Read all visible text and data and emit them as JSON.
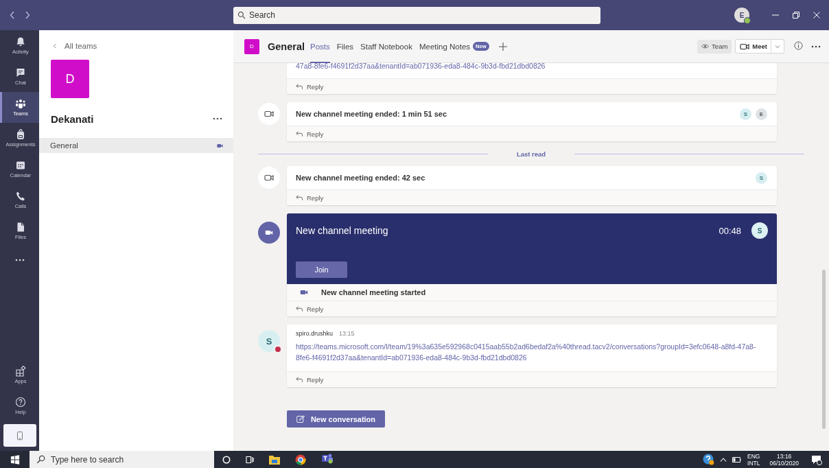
{
  "title_bar": {
    "search": {
      "placeholder": "Search"
    },
    "user": {
      "initial": "E",
      "color": "#92c353"
    }
  },
  "app_bar": {
    "items": [
      {
        "label": "Activity",
        "selected": false
      },
      {
        "label": "Chat",
        "selected": false
      },
      {
        "label": "Teams",
        "selected": true
      },
      {
        "label": "Assignments",
        "selected": false
      },
      {
        "label": "Calendar",
        "selected": false
      },
      {
        "label": "Calls",
        "selected": false
      },
      {
        "label": "Files",
        "selected": false
      }
    ],
    "bottom_items": [
      {
        "label": "Apps"
      },
      {
        "label": "Help"
      }
    ]
  },
  "team_panel": {
    "back_link": "All teams",
    "team_initial": "D",
    "team_name": "Dekanati",
    "channels": [
      {
        "name": "General",
        "selected": true,
        "meeting_active": true
      }
    ]
  },
  "channel_header": {
    "team_initial": "D",
    "channel_name": "General",
    "tabs": [
      {
        "label": "Posts",
        "selected": true
      },
      {
        "label": "Files",
        "selected": false
      },
      {
        "label": "Staff Notebook",
        "selected": false
      },
      {
        "label": "Meeting Notes",
        "selected": false,
        "badge": "New"
      }
    ],
    "team_button": "Team",
    "meet_button": "Meet"
  },
  "posts": [
    {
      "kind": "link_tail",
      "link": "47a8-8fe6-f4691f2d37aa&tenantId=ab071936-eda8-484c-9b3d-fbd21dbd0826",
      "reply": "Reply"
    },
    {
      "kind": "event",
      "text": "New channel meeting ended: 1 min 51 sec",
      "participants": [
        "S",
        "E"
      ],
      "reply": "Reply"
    },
    {
      "kind": "divider",
      "label": "Last read"
    },
    {
      "kind": "event",
      "text": "New channel meeting ended: 42 sec",
      "participants": [
        "S"
      ],
      "reply": "Reply"
    },
    {
      "kind": "meeting",
      "title": "New channel meeting",
      "duration": "00:48",
      "participants": [
        "S"
      ],
      "join": "Join",
      "status": "New channel meeting started",
      "reply": "Reply"
    },
    {
      "kind": "message",
      "initial": "S",
      "color": "#c4314b",
      "author": "spiro.drushku",
      "time": "13:15",
      "link": "https://teams.microsoft.com/l/team/19%3a635e592968c0415aab55b2ad6bedaf2a%40thread.tacv2/conversations?groupId=3efc0648-a8fd-47a8-8fe6-f4691f2d37aa&tenantId=ab071936-eda8-484c-9b3d-fbd21dbd0826",
      "reply": "Reply"
    }
  ],
  "new_conversation": "New conversation",
  "taskbar": {
    "search": {
      "placeholder": "Type here to search"
    },
    "language": "ENG",
    "layout": "INTL",
    "time": "13:16",
    "date": "06/10/2020"
  }
}
